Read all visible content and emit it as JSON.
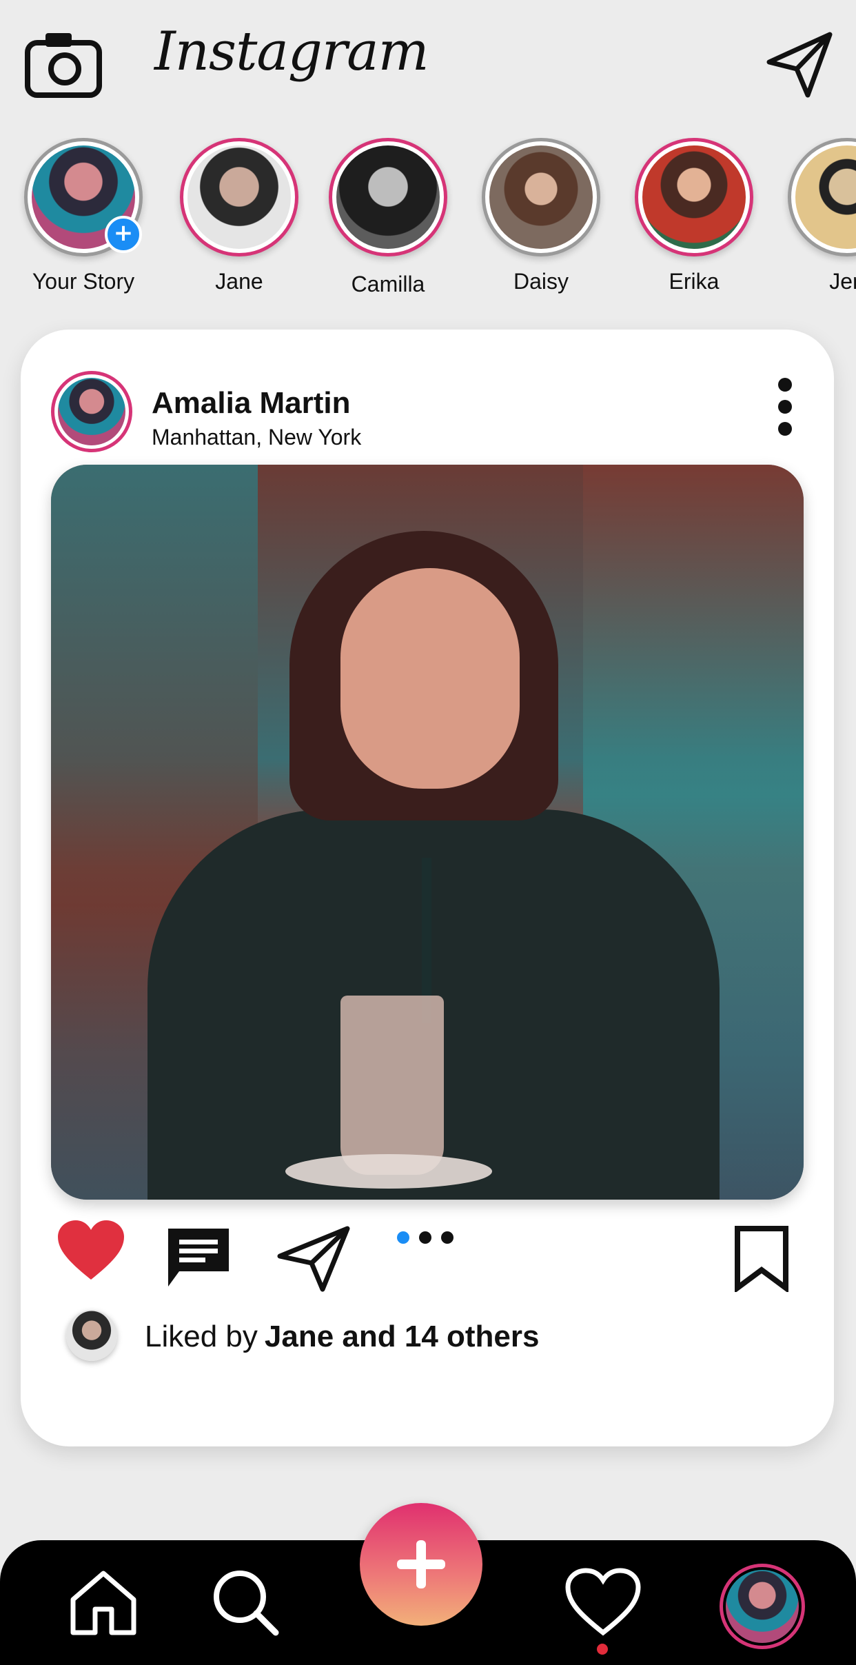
{
  "app": {
    "title": "Instagram"
  },
  "stories": [
    {
      "name": "Your Story",
      "ring": "plain",
      "has_add": true
    },
    {
      "name": "Jane",
      "ring": "active"
    },
    {
      "name": "Camilla",
      "ring": "active"
    },
    {
      "name": "Daisy",
      "ring": "plain"
    },
    {
      "name": "Erika",
      "ring": "active"
    },
    {
      "name": "Jen",
      "ring": "plain"
    }
  ],
  "story_add_symbol": "+",
  "post": {
    "author": "Amalia Martin",
    "location": "Manhattan, New York",
    "carousel": {
      "count": 3,
      "active_index": 0
    },
    "likes_prefix": "Liked by",
    "likes_text": "Jane and 14 others"
  },
  "colors": {
    "story_ring": "#d63477",
    "like_heart": "#e0303f",
    "carousel_active": "#1a8df5",
    "fab_gradient_start": "#e0306f",
    "fab_gradient_end": "#f2b079",
    "nav_background": "#000000"
  },
  "icons": {
    "camera": "camera-icon",
    "direct": "paper-plane-icon",
    "more": "more-vertical-icon",
    "like": "heart-filled-icon",
    "comment": "comment-icon",
    "share": "paper-plane-icon",
    "save": "bookmark-icon",
    "home": "home-icon",
    "search": "search-icon",
    "add": "plus-icon",
    "activity": "heart-outline-icon"
  }
}
